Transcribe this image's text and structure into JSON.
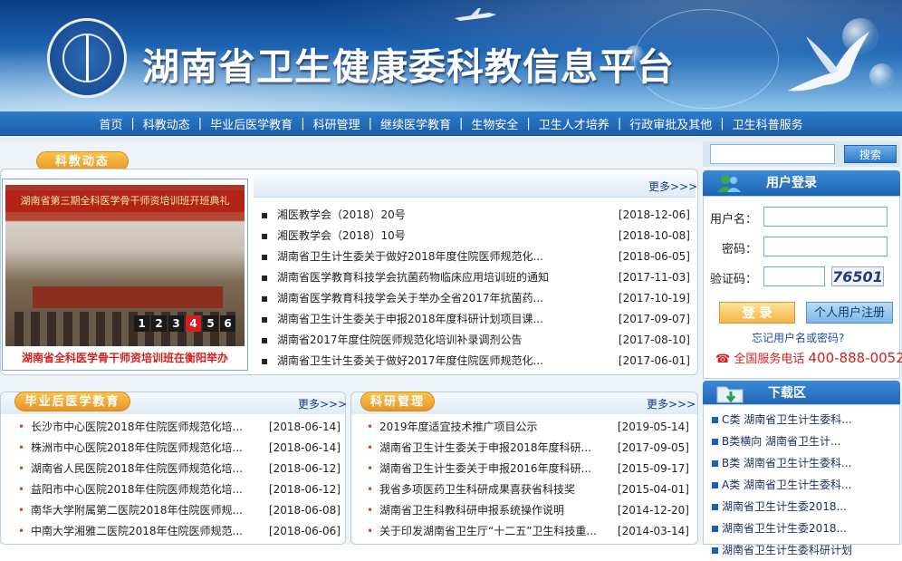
{
  "banner": {
    "title": "湖南省卫生健康委科教信息平台"
  },
  "nav": {
    "items": [
      "首页",
      "科教动态",
      "毕业后医学教育",
      "科研管理",
      "继续医学教育",
      "生物安全",
      "卫生人才培养",
      "行政审批及其他",
      "卫生科普服务"
    ]
  },
  "news": {
    "tab": "科教动态",
    "more": "更多>>>",
    "items": [
      {
        "title": "湘医教学会（2018）20号",
        "date": "[2018-12-06]"
      },
      {
        "title": "湘医教学会（2018）10号",
        "date": "[2018-10-08]"
      },
      {
        "title": "湖南省卫生计生委关于做好2018年度住院医师规范化...",
        "date": "[2018-06-05]"
      },
      {
        "title": "湖南省医学教育科技学会抗菌药物临床应用培训班的通知",
        "date": "[2017-11-03]"
      },
      {
        "title": "湖南省医学教育科技学会关于举办全省2017年抗菌药...",
        "date": "[2017-10-19]"
      },
      {
        "title": "湖南省卫生计生委关于申报2018年度科研计划项目课...",
        "date": "[2017-09-07]"
      },
      {
        "title": "湖南省2017年度住院医师规范化培训补录调剂公告",
        "date": "[2017-08-10]"
      },
      {
        "title": "湖南省卫生计生委关于做好2017年度住院医师规范化...",
        "date": "[2017-06-01]"
      }
    ]
  },
  "slideshow": {
    "caption": "湖南省全科医学骨干师资培训班在衡阳举办",
    "banner_text": "湖南省第三期全科医学骨干师资培训班开班典礼",
    "pages": [
      "1",
      "2",
      "3",
      "4",
      "5",
      "6"
    ],
    "active": "4"
  },
  "grad": {
    "tab": "毕业后医学教育",
    "more": "更多>>>",
    "items": [
      {
        "title": "长沙市中心医院2018年住院医师规范化培...",
        "date": "[2018-06-14]"
      },
      {
        "title": "株洲市中心医院2018年住院医师规范化培...",
        "date": "[2018-06-14]"
      },
      {
        "title": "湖南省人民医院2018年住院医师规范化培...",
        "date": "[2018-06-12]"
      },
      {
        "title": "益阳市中心医院2018年住院医师规范化培...",
        "date": "[2018-06-12]"
      },
      {
        "title": "南华大学附属第二医院2018年住院医师规...",
        "date": "[2018-06-08]"
      },
      {
        "title": "中南大学湘雅二医院2018年住院医师规范...",
        "date": "[2018-06-06]"
      }
    ]
  },
  "research": {
    "tab": "科研管理",
    "more": "更多>>>",
    "items": [
      {
        "title": "2019年度适宜技术推广项目公示",
        "date": "[2019-05-14]"
      },
      {
        "title": "湖南省卫生计生委关于申报2018年度科研...",
        "date": "[2017-09-05]"
      },
      {
        "title": "湖南省卫生计生委关于申报2016年度科研...",
        "date": "[2015-09-17]"
      },
      {
        "title": "我省多项医药卫生科研成果喜获省科技奖",
        "date": "[2015-04-01]"
      },
      {
        "title": "湖南省卫生科教科研申报系统操作说明",
        "date": "[2014-12-20]"
      },
      {
        "title": "关于印发湖南省卫生厅“十二五”卫生科技重...",
        "date": "[2014-03-14]"
      }
    ]
  },
  "search": {
    "button": "搜索"
  },
  "login": {
    "title": "用户登录",
    "username_label": "用户名：",
    "password_label": "密码：",
    "captcha_label": "验证码：",
    "captcha_value": "76501",
    "login_button": "登 录",
    "register_button": "个人用户注册",
    "forgot": "忘记用户名或密码?",
    "hotline_label": "全国服务电话",
    "hotline_number": "400-888-0052"
  },
  "downloads": {
    "title": "下载区",
    "items": [
      "C类 湖南省卫生计生委科...",
      "B类横向 湖南省卫生计...",
      "B类 湖南省卫生计生委科...",
      "A类 湖南省卫生计生委科...",
      "湖南省卫生计生委2018...",
      "湖南省卫生计生委2018...",
      "湖南省卫生计生委科研计划"
    ]
  }
}
